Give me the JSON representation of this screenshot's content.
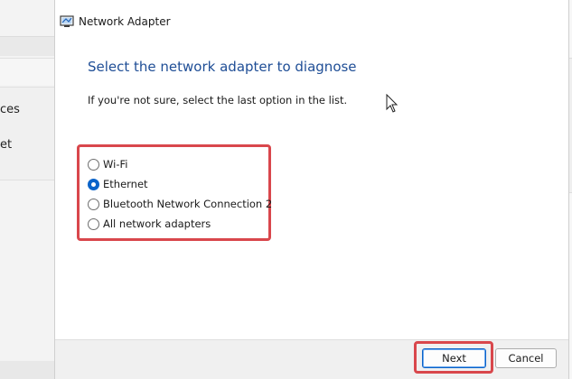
{
  "background_window": {
    "item_1_partial": "ces",
    "item_2_partial": "et"
  },
  "dialog": {
    "title": "Network Adapter",
    "heading": "Select the network adapter to diagnose",
    "instruction": "If you're not sure, select the last option in the list.",
    "options": [
      {
        "label": "Wi-Fi",
        "checked": false
      },
      {
        "label": "Ethernet",
        "checked": true
      },
      {
        "label": "Bluetooth Network Connection 2",
        "checked": false
      },
      {
        "label": "All network adapters",
        "checked": false
      }
    ],
    "buttons": {
      "next": "Next",
      "cancel": "Cancel"
    }
  },
  "colors": {
    "heading": "#1f4e96",
    "highlight": "#d9474c",
    "radio_selected": "#0a63c9"
  },
  "icons": {
    "title_icon": "network-adapter-icon",
    "cursor": "mouse-pointer-icon"
  }
}
